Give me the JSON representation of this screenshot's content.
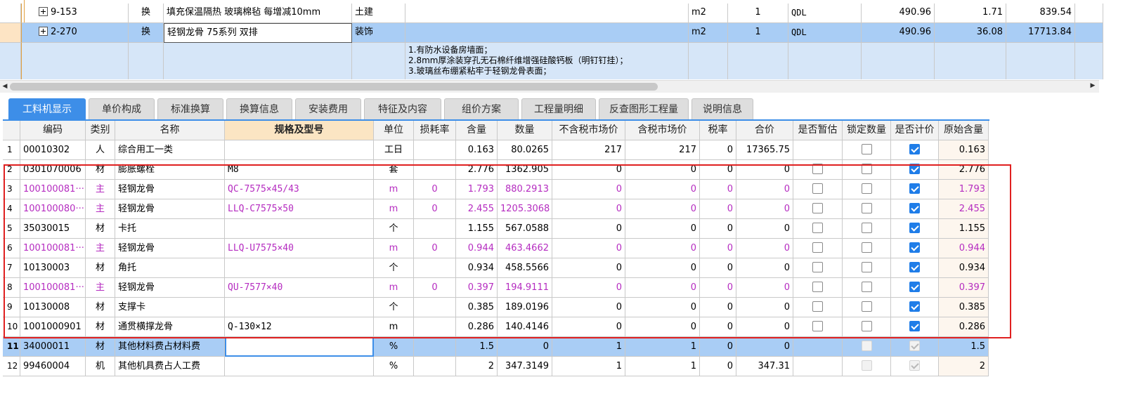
{
  "top_grid": {
    "rows": [
      {
        "code": "9-153",
        "type": "换",
        "name": "填充保温隔热 玻璃棉毡 每增减10mm",
        "major": "土建",
        "spec": "",
        "unit": "m2",
        "qty": "1",
        "formula": "QDL",
        "price": "490.96",
        "amount": "1.71",
        "total": "839.54"
      },
      {
        "code": "2-270",
        "type": "换",
        "name": "轻钢龙骨 75系列 双排",
        "major": "装饰",
        "spec": "",
        "unit": "m2",
        "qty": "1",
        "formula": "QDL",
        "price": "490.96",
        "amount": "36.08",
        "total": "17713.84"
      }
    ],
    "features": [
      "1.有防水设备房墙面；",
      "2.8mm厚涂装穿孔无石棉纤维增强硅酸钙板（明钉钉挂）；",
      "3.玻璃丝布绷紧粘牢于轻钢龙骨表面；"
    ]
  },
  "tabs": [
    "工料机显示",
    "单价构成",
    "标准换算",
    "换算信息",
    "安装费用",
    "特征及内容",
    "组价方案",
    "工程量明细",
    "反查图形工程量",
    "说明信息"
  ],
  "active_tab": 0,
  "grid": {
    "headers": [
      "",
      "编码",
      "类别",
      "名称",
      "规格及型号",
      "单位",
      "损耗率",
      "含量",
      "数量",
      "不含税市场价",
      "含税市场价",
      "税率",
      "合价",
      "是否暂估",
      "锁定数量",
      "是否计价",
      "原始含量"
    ],
    "rows": [
      {
        "no": "1",
        "code": "00010302",
        "type": "人",
        "name": "综合用工一类",
        "spec": "",
        "unit": "工日",
        "loss": "",
        "content": "0.163",
        "qty": "80.0265",
        "price_ex": "217",
        "price_in": "217",
        "tax": "0",
        "total": "17365.75",
        "est": "",
        "lock": "off",
        "count": "on",
        "orig": "0.163",
        "purple": false
      },
      {
        "no": "2",
        "code": "0301070006",
        "type": "材",
        "name": "膨胀螺栓",
        "spec": "M8",
        "unit": "套",
        "loss": "",
        "content": "2.776",
        "qty": "1362.905",
        "price_ex": "0",
        "price_in": "0",
        "tax": "0",
        "total": "0",
        "est": "off",
        "lock": "off",
        "count": "on",
        "orig": "2.776",
        "purple": false
      },
      {
        "no": "3",
        "code": "100100081···",
        "type": "主",
        "name": "轻钢龙骨",
        "spec": "QC-7575×45/43",
        "unit": "m",
        "loss": "0",
        "content": "1.793",
        "qty": "880.2913",
        "price_ex": "0",
        "price_in": "0",
        "tax": "0",
        "total": "0",
        "est": "off",
        "lock": "off",
        "count": "on",
        "orig": "1.793",
        "purple": true
      },
      {
        "no": "4",
        "code": "100100080···",
        "type": "主",
        "name": "轻钢龙骨",
        "spec": "LLQ-C7575×50",
        "unit": "m",
        "loss": "0",
        "content": "2.455",
        "qty": "1205.3068",
        "price_ex": "0",
        "price_in": "0",
        "tax": "0",
        "total": "0",
        "est": "off",
        "lock": "off",
        "count": "on",
        "orig": "2.455",
        "purple": true
      },
      {
        "no": "5",
        "code": "35030015",
        "type": "材",
        "name": "卡托",
        "spec": "",
        "unit": "个",
        "loss": "",
        "content": "1.155",
        "qty": "567.0588",
        "price_ex": "0",
        "price_in": "0",
        "tax": "0",
        "total": "0",
        "est": "off",
        "lock": "off",
        "count": "on",
        "orig": "1.155",
        "purple": false
      },
      {
        "no": "6",
        "code": "100100081···",
        "type": "主",
        "name": "轻钢龙骨",
        "spec": "LLQ-U7575×40",
        "unit": "m",
        "loss": "0",
        "content": "0.944",
        "qty": "463.4662",
        "price_ex": "0",
        "price_in": "0",
        "tax": "0",
        "total": "0",
        "est": "off",
        "lock": "off",
        "count": "on",
        "orig": "0.944",
        "purple": true
      },
      {
        "no": "7",
        "code": "10130003",
        "type": "材",
        "name": "角托",
        "spec": "",
        "unit": "个",
        "loss": "",
        "content": "0.934",
        "qty": "458.5566",
        "price_ex": "0",
        "price_in": "0",
        "tax": "0",
        "total": "0",
        "est": "off",
        "lock": "off",
        "count": "on",
        "orig": "0.934",
        "purple": false
      },
      {
        "no": "8",
        "code": "100100081···",
        "type": "主",
        "name": "轻钢龙骨",
        "spec": "QU-7577×40",
        "unit": "m",
        "loss": "0",
        "content": "0.397",
        "qty": "194.9111",
        "price_ex": "0",
        "price_in": "0",
        "tax": "0",
        "total": "0",
        "est": "off",
        "lock": "off",
        "count": "on",
        "orig": "0.397",
        "purple": true
      },
      {
        "no": "9",
        "code": "10130008",
        "type": "材",
        "name": "支撑卡",
        "spec": "",
        "unit": "个",
        "loss": "",
        "content": "0.385",
        "qty": "189.0196",
        "price_ex": "0",
        "price_in": "0",
        "tax": "0",
        "total": "0",
        "est": "off",
        "lock": "off",
        "count": "on",
        "orig": "0.385",
        "purple": false
      },
      {
        "no": "10",
        "code": "1001000901",
        "type": "材",
        "name": "通贯横撑龙骨",
        "spec": "Q-130×12",
        "unit": "m",
        "loss": "",
        "content": "0.286",
        "qty": "140.4146",
        "price_ex": "0",
        "price_in": "0",
        "tax": "0",
        "total": "0",
        "est": "off",
        "lock": "off",
        "count": "on",
        "orig": "0.286",
        "purple": false
      },
      {
        "no": "11",
        "code": "34000011",
        "type": "材",
        "name": "其他材料费占材料费",
        "spec": "",
        "unit": "%",
        "loss": "",
        "content": "1.5",
        "qty": "0",
        "price_ex": "1",
        "price_in": "1",
        "tax": "0",
        "total": "0",
        "est": "",
        "lock": "dis",
        "count": "dison",
        "orig": "1.5",
        "purple": false,
        "selected": true
      },
      {
        "no": "12",
        "code": "99460004",
        "type": "机",
        "name": "其他机具费占人工费",
        "spec": "",
        "unit": "%",
        "loss": "",
        "content": "2",
        "qty": "347.3149",
        "price_ex": "1",
        "price_in": "1",
        "tax": "0",
        "total": "347.31",
        "est": "",
        "lock": "dis",
        "count": "dison",
        "orig": "2",
        "purple": false
      }
    ]
  },
  "colors": {
    "accent": "#3d8ee8",
    "purple": "#b52cc0",
    "highlight_box": "#e02020",
    "selected_row": "#a9cdf5"
  }
}
